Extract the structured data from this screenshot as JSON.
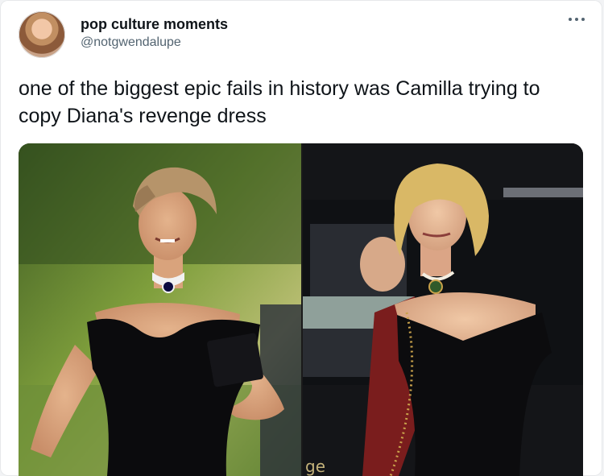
{
  "tweet": {
    "author_name": "pop culture moments",
    "author_handle": "@notgwendalupe",
    "text": "one of the biggest epic fails in history was Camilla trying to copy Diana's revenge dress",
    "more_icon": "more-horizontal-icon"
  },
  "media": {
    "left_image": "photo-diana-black-off-shoulder-dress",
    "right_image": "photo-camilla-black-off-shoulder-dress",
    "corner_text": "ge"
  },
  "colors": {
    "text": "#0f1419",
    "secondary": "#536471",
    "background": "#ffffff"
  }
}
